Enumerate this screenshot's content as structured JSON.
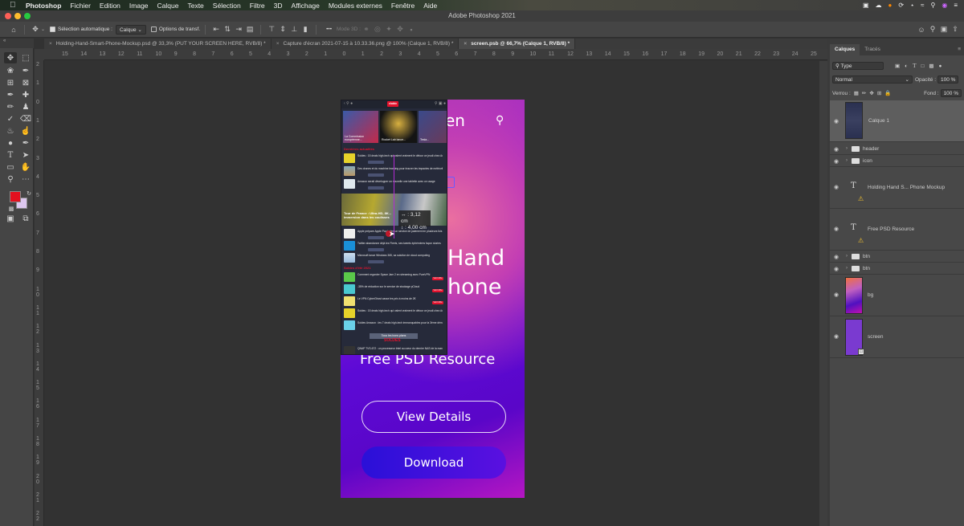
{
  "menubar": {
    "app_name": "Photoshop",
    "items": [
      "Fichier",
      "Edition",
      "Image",
      "Calque",
      "Texte",
      "Sélection",
      "Filtre",
      "3D",
      "Affichage",
      "Modules externes",
      "Fenêtre",
      "Aide"
    ],
    "status_icons": [
      "screen-record-icon",
      "creative-cloud-icon",
      "bluetooth-icon",
      "sync-icon",
      "wifi-icon",
      "search-icon",
      "siri-icon",
      "control-center-icon"
    ]
  },
  "window": {
    "title": "Adobe Photoshop 2021"
  },
  "options_bar": {
    "auto_select_label": "Sélection automatique :",
    "auto_select_checked": true,
    "auto_select_target": "Calque",
    "transform_label": "Options de transf.",
    "transform_checked": false,
    "more_label": "•••",
    "mode3d_label": "Mode 3D :"
  },
  "tabs": [
    {
      "label": "Holding-Hand-Smart-Phone-Mockup.psd @ 33,3% (PUT YOUR SCREEN HERE, RVB/8) *",
      "active": false
    },
    {
      "label": "Capture d'écran 2021-07-15 à 10.33.36.png @ 100% (Calque 1, RVB/8) *",
      "active": false
    },
    {
      "label": "screen.psb @ 66,7% (Calque 1, RVB/8) *",
      "active": true
    }
  ],
  "rulers": {
    "top": [
      "15",
      "14",
      "13",
      "12",
      "11",
      "10",
      "9",
      "8",
      "7",
      "6",
      "5",
      "4",
      "3",
      "2",
      "1",
      "0",
      "1",
      "2",
      "3",
      "4",
      "5",
      "6",
      "7",
      "8",
      "9",
      "10",
      "11",
      "12",
      "13",
      "14",
      "15",
      "16",
      "17",
      "18",
      "19",
      "20",
      "21",
      "22",
      "23",
      "24",
      "25"
    ],
    "left": [
      "2",
      "1",
      "0",
      "1",
      "2",
      "3",
      "4",
      "5",
      "6",
      "7",
      "8",
      "9",
      "10",
      "11",
      "12",
      "13",
      "14",
      "15",
      "16",
      "17",
      "18",
      "19",
      "20",
      "21",
      "22"
    ]
  },
  "tools": {
    "foreground_color": "#e3101e",
    "background_color": "#dcc6ee"
  },
  "artboard": {
    "brand_partial": "en",
    "headline_line1": "Hand",
    "headline_line2": "hone",
    "subtitle": "Free PSD Resource",
    "view_details_label": "View Details",
    "download_label": "Download"
  },
  "screenshot_layer": {
    "logo": "clubic",
    "section_latest": "Dernières actualités",
    "section_deals": "Soldes d'été 2021",
    "big_caption": "Tour de France : Ultra-HD, 8K... immersion dans les coulisses",
    "all_deals_label": "Tous les bons plans",
    "soldes_label": "SOLDES",
    "news": [
      "Soldes : 15 deals high-tech qui valent vraiment le détour ce jeudi chez Amazon et Cdiscount",
      "Des drones et du machine learning pour trouver les impactes de météorites",
      "Amazon serait développer un nouvelle une tablette avec un usage",
      "Apple prépare Apple Pay Later, un service de paiement en plusieurs fois",
      "Twitter abandonne déjà les Fleets, ses tweets éphémères façon stories",
      "Microsoft lance Windows 365, sa solution de cloud computing"
    ],
    "deals": [
      "Comment regarder Space Jam 2 en streaming avec PureVPN",
      "-35% de réduction sur le service de stockage pCloud",
      "Le VPN CyberGhost casse les prix à moins de 2€",
      "Soldes : 15 deals high-tech qui valent vraiment le détour ce jeudi chez Amazon et Cdiscount",
      "Soldes Amazon : les 7 deals high-tech immanquables pour la 3ème démarque",
      "QNAP TVS-672 : un processeur Intel au cœur du dernier NAS de la marque"
    ],
    "deal_button": "Voir l'offre"
  },
  "measure_readout": {
    "width": "↔ : 3,12 cm",
    "height": "↕ : 4,00 cm"
  },
  "layers_panel": {
    "tabs": [
      "Calques",
      "Tracés"
    ],
    "filter_label": "Type",
    "blend_mode": "Normal",
    "opacity_label": "Opacité :",
    "opacity_value": "100 %",
    "lock_label": "Verrou :",
    "fill_label": "Fond :",
    "fill_value": "100 %",
    "layers": [
      {
        "name": "Calque 1",
        "type": "pixel",
        "selected": true
      },
      {
        "name": "header",
        "type": "group"
      },
      {
        "name": "icon",
        "type": "group"
      },
      {
        "name": "Holding Hand S... Phone Mockup",
        "type": "text",
        "warning": true
      },
      {
        "name": "Free PSD Resource",
        "type": "text",
        "warning": true
      },
      {
        "name": "btn",
        "type": "group"
      },
      {
        "name": "btn",
        "type": "group"
      },
      {
        "name": "bg",
        "type": "pixel"
      },
      {
        "name": "screen",
        "type": "smart-object"
      }
    ]
  }
}
